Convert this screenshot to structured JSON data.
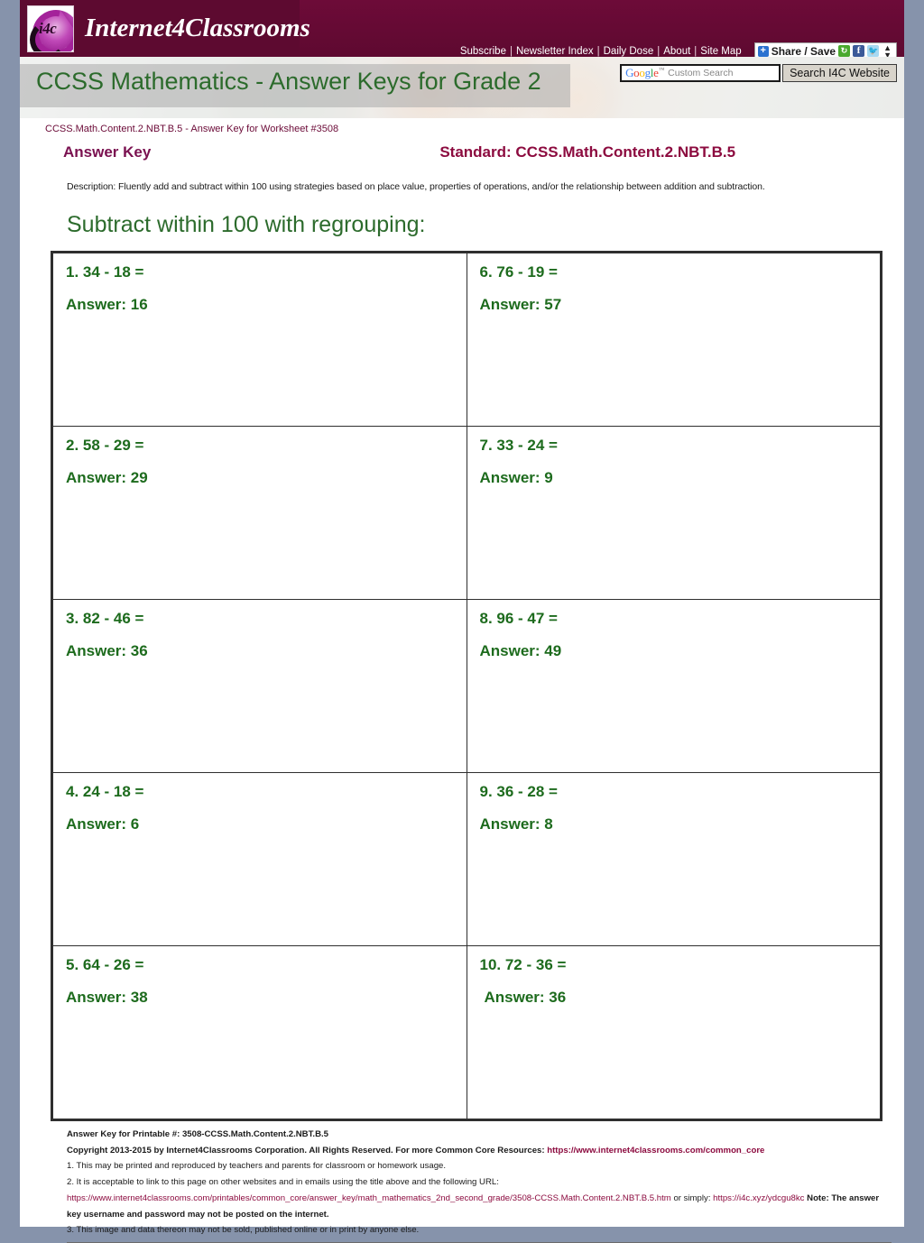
{
  "site": {
    "brand_name": "Internet4Classrooms",
    "logo_text": "i4c",
    "nav": [
      {
        "label": "Subscribe"
      },
      {
        "label": "Newsletter Index"
      },
      {
        "label": "Daily Dose"
      },
      {
        "label": "About"
      },
      {
        "label": "Site Map"
      }
    ],
    "nav_separator": "|",
    "share": {
      "plus": "+",
      "label": "Share / Save",
      "facebook_glyph": "f",
      "twitter_glyph": "t",
      "arrows_up": "▲",
      "arrows_down": "▼"
    },
    "search": {
      "google_g": "G",
      "google_o1": "o",
      "google_o2": "o",
      "google_g2": "g",
      "google_l": "l",
      "google_e": "e",
      "trademark": "™",
      "placeholder": "Custom Search",
      "button_label": "Search I4C Website"
    }
  },
  "banner": {
    "title": "CCSS Mathematics - Answer Keys for Grade 2"
  },
  "header": {
    "worksheet_line": "CCSS.Math.Content.2.NBT.B.5 - Answer Key for Worksheet #3508",
    "answer_key_label": "Answer Key",
    "standard_label": "Standard: CCSS.Math.Content.2.NBT.B.5",
    "description": "Description: Fluently add and subtract within 100 using strategies based on place value, properties of operations, and/or the relationship between addition and subtraction.",
    "section_title": "Subtract within 100 with regrouping:"
  },
  "problems": [
    {
      "question": "1.  34 - 18 =",
      "answer": "Answer: 16"
    },
    {
      "question": "6.  76 - 19 =",
      "answer": "Answer: 57"
    },
    {
      "question": "2.  58 - 29 =",
      "answer": "Answer: 29"
    },
    {
      "question": "7.  33 - 24 =",
      "answer": "Answer: 9"
    },
    {
      "question": "3.  82 - 46 =",
      "answer": "Answer: 36"
    },
    {
      "question": "8.  96 - 47 =",
      "answer": "Answer: 49"
    },
    {
      "question": "4.  24 - 18 =",
      "answer": "Answer: 6"
    },
    {
      "question": "9.  36 - 28 =",
      "answer": "Answer: 8"
    },
    {
      "question": "5.  64 - 26 =",
      "answer": "Answer: 38"
    },
    {
      "question": "10.  72 - 36 =",
      "answer": "Answer: 36"
    }
  ],
  "footer": {
    "printable_line": "Answer Key for Printable #: 3508-CCSS.Math.Content.2.NBT.B.5",
    "copyright_text": "Copyright 2013-2015 by Internet4Classrooms Corporation. All Rights Reserved. For more Common Core Resources:",
    "copyright_link": "https://www.internet4classrooms.com/common_core",
    "item1": "1. This may be printed and reproduced by teachers and parents for classroom or homework usage.",
    "item2": "2. It is acceptable to link to this page on other websites and in emails using the title above and the following URL:",
    "long_url": "https://www.internet4classrooms.com/printables/common_core/answer_key/math_mathematics_2nd_second_grade/3508-CCSS.Math.Content.2.NBT.B.5.htm",
    "or_simply": "or simply:",
    "short_url": "https://i4c.xyz/ydcgu8kc",
    "note": "Note: The answer key username and password may not be posted on the internet.",
    "item3": "3. This image and data thereon may not be sold, published online or in print by anyone else."
  },
  "colors": {
    "brand_maroon": "#6b0a37",
    "heading_green": "#2c6b2c",
    "answer_green": "#1d6b1d",
    "standard_maroon": "#8c0b3f",
    "page_bg": "#8693ab"
  }
}
